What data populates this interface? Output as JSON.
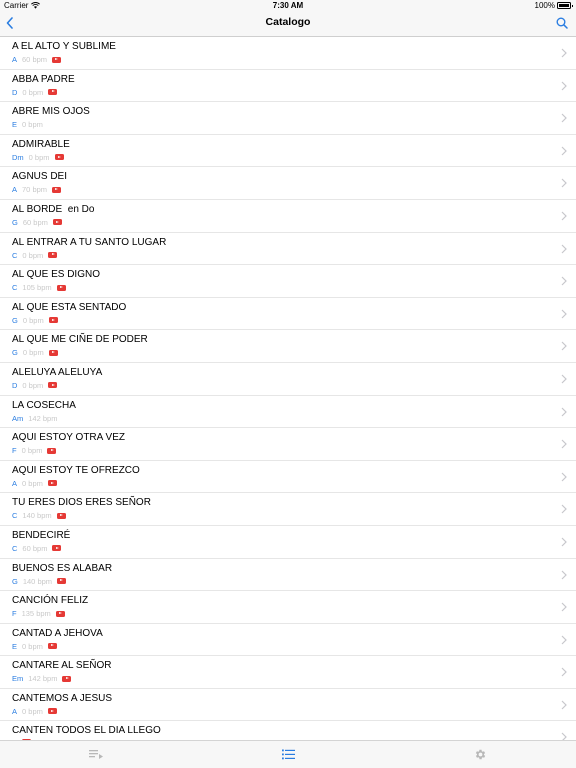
{
  "status_bar": {
    "carrier": "Carrier",
    "time": "7:30 AM",
    "battery": "100%"
  },
  "nav": {
    "title": "Catalogo",
    "back_icon": "chevron-left-icon",
    "search_icon": "search-icon"
  },
  "colors": {
    "accent": "#2a7de1",
    "bpm_text": "#c9c9c9",
    "video_badge": "#e53935",
    "bar_background": "#f7f7f7"
  },
  "songs": [
    {
      "title": "A EL ALTO Y SUBLIME",
      "key": "A",
      "bpm": "60 bpm",
      "video": true
    },
    {
      "title": "ABBA PADRE",
      "key": "D",
      "bpm": "0 bpm",
      "video": true
    },
    {
      "title": "ABRE MIS OJOS",
      "key": "E",
      "bpm": "0 bpm",
      "video": false
    },
    {
      "title": "ADMIRABLE",
      "key": "Dm",
      "bpm": "0 bpm",
      "video": true
    },
    {
      "title": "AGNUS DEI",
      "key": "A",
      "bpm": "70 bpm",
      "video": true
    },
    {
      "title": "AL BORDE  en Do",
      "key": "G",
      "bpm": "60 bpm",
      "video": true
    },
    {
      "title": "AL ENTRAR A TU SANTO LUGAR",
      "key": "C",
      "bpm": "0 bpm",
      "video": true
    },
    {
      "title": "AL QUE ES DIGNO",
      "key": "C",
      "bpm": "105 bpm",
      "video": true
    },
    {
      "title": "AL QUE ESTA SENTADO",
      "key": "G",
      "bpm": "0 bpm",
      "video": true
    },
    {
      "title": "AL QUE ME CIÑE DE PODER",
      "key": "G",
      "bpm": "0 bpm",
      "video": true
    },
    {
      "title": "ALELUYA ALELUYA",
      "key": "D",
      "bpm": "0 bpm",
      "video": true
    },
    {
      "title": "LA COSECHA",
      "key": "Am",
      "bpm": "142 bpm",
      "video": false
    },
    {
      "title": "AQUI ESTOY OTRA VEZ",
      "key": "F",
      "bpm": "0 bpm",
      "video": true
    },
    {
      "title": "AQUI ESTOY TE OFREZCO",
      "key": "A",
      "bpm": "0 bpm",
      "video": true
    },
    {
      "title": "TU ERES DIOS ERES SEÑOR",
      "key": "C",
      "bpm": "140 bpm",
      "video": true
    },
    {
      "title": "BENDECIRÉ",
      "key": "C",
      "bpm": "60 bpm",
      "video": true
    },
    {
      "title": "BUENOS ES ALABAR",
      "key": "G",
      "bpm": "140 bpm",
      "video": true
    },
    {
      "title": "CANCIÓN FELIZ",
      "key": "F",
      "bpm": "135 bpm",
      "video": true
    },
    {
      "title": "CANTAD A JEHOVA",
      "key": "E",
      "bpm": "0 bpm",
      "video": true
    },
    {
      "title": "CANTARE AL SEÑOR",
      "key": "Em",
      "bpm": "142 bpm",
      "video": true
    },
    {
      "title": "CANTEMOS A JESUS",
      "key": "A",
      "bpm": "0 bpm",
      "video": true
    },
    {
      "title": "CANTEN TODOS EL DIA LLEGO",
      "key": "",
      "bpm": "",
      "video": true
    }
  ],
  "tabs": [
    {
      "icon": "playlist-icon",
      "active": false
    },
    {
      "icon": "list-icon",
      "active": true
    },
    {
      "icon": "gear-icon",
      "active": false
    }
  ]
}
